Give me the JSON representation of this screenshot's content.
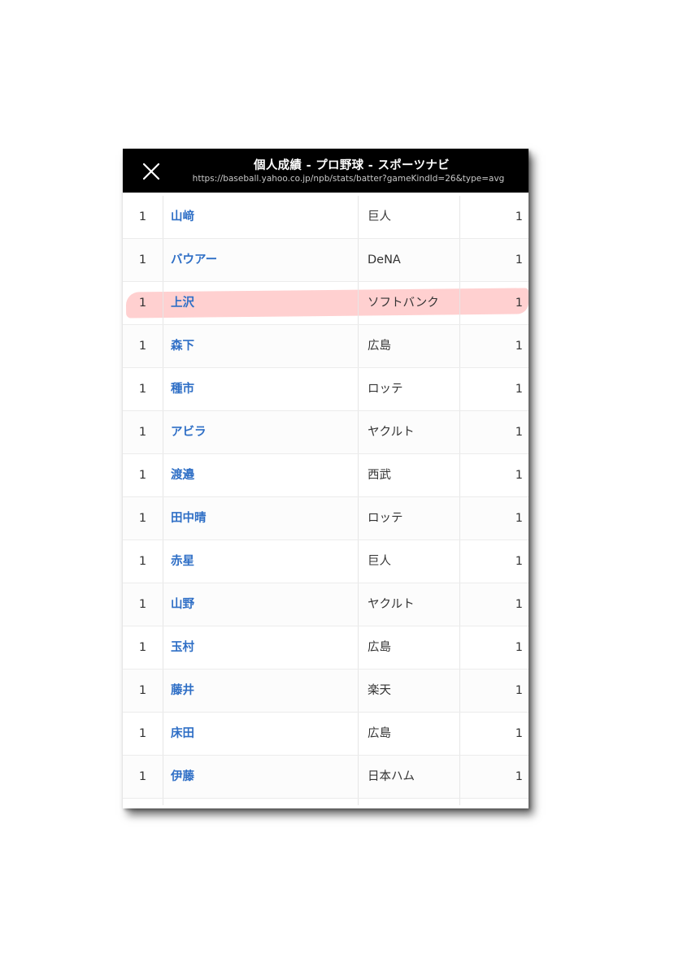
{
  "header": {
    "title": "個人成績 - プロ野球 - スポーツナビ",
    "url": "https://baseball.yahoo.co.jp/npb/stats/batter?gameKindId=26&type=avg"
  },
  "colors": {
    "header_bg": "#000000",
    "player_link": "#2f6fc6",
    "highlight": "#ffb3b3"
  },
  "highlighted_row": 2,
  "rows": [
    {
      "rank": "1",
      "name": "山﨑",
      "team": "巨人",
      "value": "1"
    },
    {
      "rank": "1",
      "name": "バウアー",
      "team": "DeNA",
      "value": "1"
    },
    {
      "rank": "1",
      "name": "上沢",
      "team": "ソフトバンク",
      "value": "1"
    },
    {
      "rank": "1",
      "name": "森下",
      "team": "広島",
      "value": "1"
    },
    {
      "rank": "1",
      "name": "種市",
      "team": "ロッテ",
      "value": "1"
    },
    {
      "rank": "1",
      "name": "アビラ",
      "team": "ヤクルト",
      "value": "1"
    },
    {
      "rank": "1",
      "name": "渡邉",
      "team": "西武",
      "value": "1"
    },
    {
      "rank": "1",
      "name": "田中晴",
      "team": "ロッテ",
      "value": "1"
    },
    {
      "rank": "1",
      "name": "赤星",
      "team": "巨人",
      "value": "1"
    },
    {
      "rank": "1",
      "name": "山野",
      "team": "ヤクルト",
      "value": "1"
    },
    {
      "rank": "1",
      "name": "玉村",
      "team": "広島",
      "value": "1"
    },
    {
      "rank": "1",
      "name": "藤井",
      "team": "楽天",
      "value": "1"
    },
    {
      "rank": "1",
      "name": "床田",
      "team": "広島",
      "value": "1"
    },
    {
      "rank": "1",
      "name": "伊藤",
      "team": "日本ハム",
      "value": "1"
    }
  ]
}
